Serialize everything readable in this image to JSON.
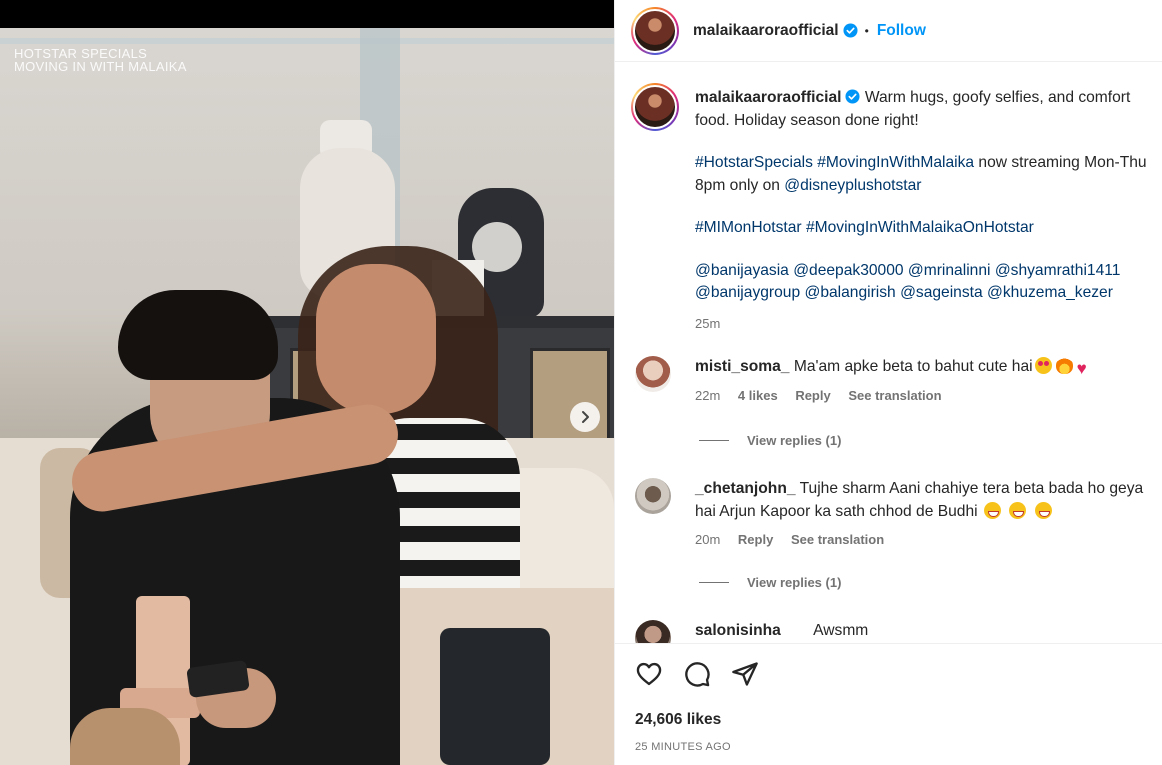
{
  "media": {
    "overlay_line1": "HOTSTAR SPECIALS",
    "overlay_line2": "MOVING IN WITH MALAIKA",
    "next_icon": "chevron-right-icon"
  },
  "header": {
    "username": "malaikaaroraofficial",
    "verified_icon": "verified-badge-icon",
    "separator": "•",
    "follow_label": "Follow"
  },
  "caption": {
    "username": "malaikaaroraofficial",
    "text": "Warm hugs, goofy selfies, and comfort food. Holiday season done right!",
    "para2_tag1": "#HotstarSpecials",
    "para2_tag2": "#MovingInWithMalaika",
    "para2_text": " now streaming Mon-Thu 8pm only on ",
    "para2_mention": "@disneyplushotstar",
    "para3_tag1": "#MIMonHotstar",
    "para3_tag2": "#MovingInWithMalaikaOnHotstar",
    "mentions": [
      "@banijayasia",
      "@deepak30000",
      "@mrinalinni",
      "@shyamrathi1411",
      "@banijaygroup",
      "@balangirish",
      "@sageinsta",
      "@khuzema_kezer"
    ],
    "time": "25m"
  },
  "comments": [
    {
      "username": "misti_soma_",
      "text": "Ma'am apke beta to bahut cute hai",
      "time": "22m",
      "likes": "4 likes",
      "reply": "Reply",
      "translate": "See translation",
      "view_replies": "View replies (1)"
    },
    {
      "username": "_chetanjohn_",
      "text": "Tujhe sharm Aani chahiye tera beta bada ho geya hai Arjun Kapoor ka sath chhod de Budhi",
      "time": "20m",
      "reply": "Reply",
      "translate": "See translation",
      "view_replies": "View replies (1)"
    },
    {
      "username": "salonisinha",
      "text": "Awsmm"
    }
  ],
  "actions": {
    "like_icon": "heart-icon",
    "comment_icon": "comment-icon",
    "share_icon": "share-icon",
    "likes": "24,606 likes",
    "posted": "25 MINUTES AGO"
  },
  "colors": {
    "link": "#00376b",
    "follow": "#0095f6",
    "verified": "#0095f6",
    "muted": "#737373"
  }
}
